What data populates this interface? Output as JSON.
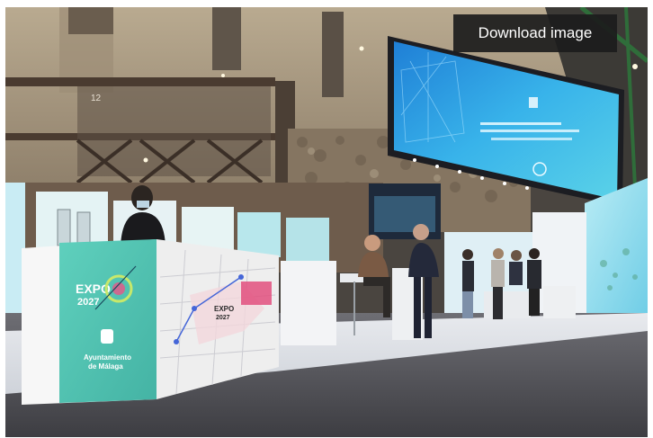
{
  "download_label": "Download image",
  "photo": {
    "scene": "Exhibition booth",
    "panel_text": {
      "expo_logo_word": "EXPO",
      "expo_logo_year": "2027",
      "city_name_line1": "Ayuntamiento",
      "city_name_line2": "de Málaga",
      "map_logo_word": "EXPO",
      "map_logo_year": "2027",
      "beam_number": "12"
    }
  },
  "colors": {
    "teal": "#5cc7b5",
    "screen_blue": "#2e9be0",
    "wall_stone": "#a89a83",
    "floor": "#4d4d52"
  }
}
